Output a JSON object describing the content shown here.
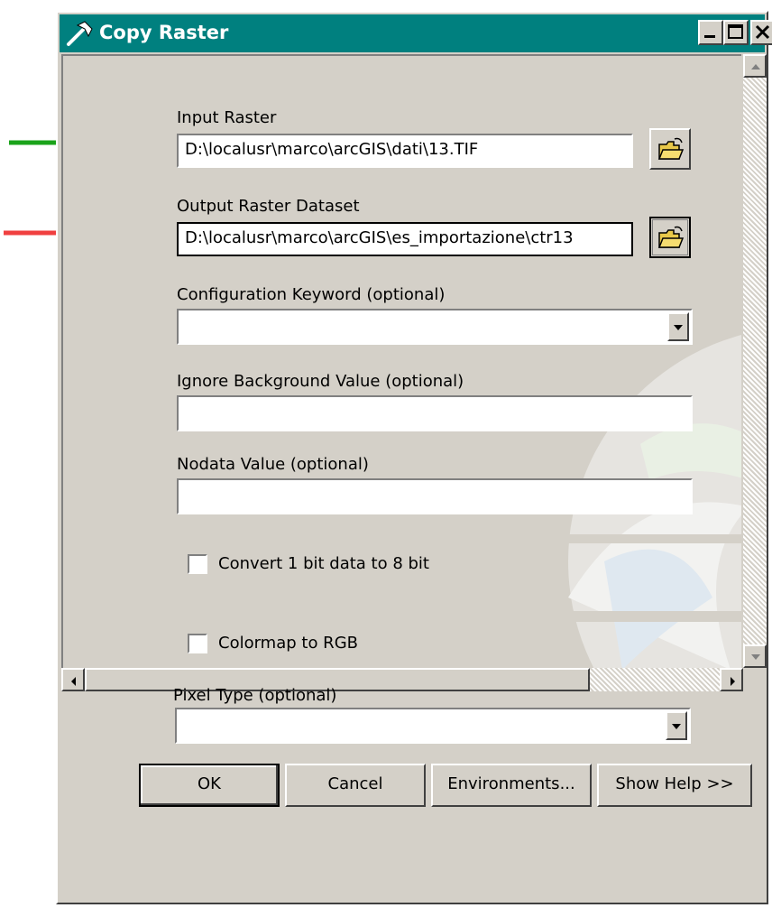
{
  "window": {
    "title": "Copy Raster",
    "controls": [
      "minimize-icon",
      "maximize-icon",
      "close-icon"
    ]
  },
  "form": {
    "input_raster": {
      "label": "Input Raster",
      "value": "D:\\localusr\\marco\\arcGIS\\dati\\13.TIF"
    },
    "output_raster": {
      "label": "Output Raster Dataset",
      "value": "D:\\localusr\\marco\\arcGIS\\es_importazione\\ctr13"
    },
    "config_keyword": {
      "label": "Configuration Keyword (optional)",
      "value": ""
    },
    "ignore_background": {
      "label": "Ignore Background Value (optional)",
      "value": ""
    },
    "nodata": {
      "label": "Nodata Value (optional)",
      "value": ""
    },
    "convert_1bit": {
      "label": "Convert 1 bit data to 8 bit",
      "checked": false
    },
    "colormap_rgb": {
      "label": "Colormap to RGB",
      "checked": false
    },
    "pixel_type": {
      "label": "Pixel Type (optional)",
      "value": ""
    }
  },
  "buttons": {
    "ok": "OK",
    "cancel": "Cancel",
    "environments": "Environments...",
    "show_help": "Show Help >>"
  },
  "annotations": {
    "green_arrow_color": "#1aa31a",
    "red_arrow_color": "#f04040"
  },
  "colors": {
    "titlebar": "#00807f",
    "dialog_bg": "#d4d0c8"
  }
}
